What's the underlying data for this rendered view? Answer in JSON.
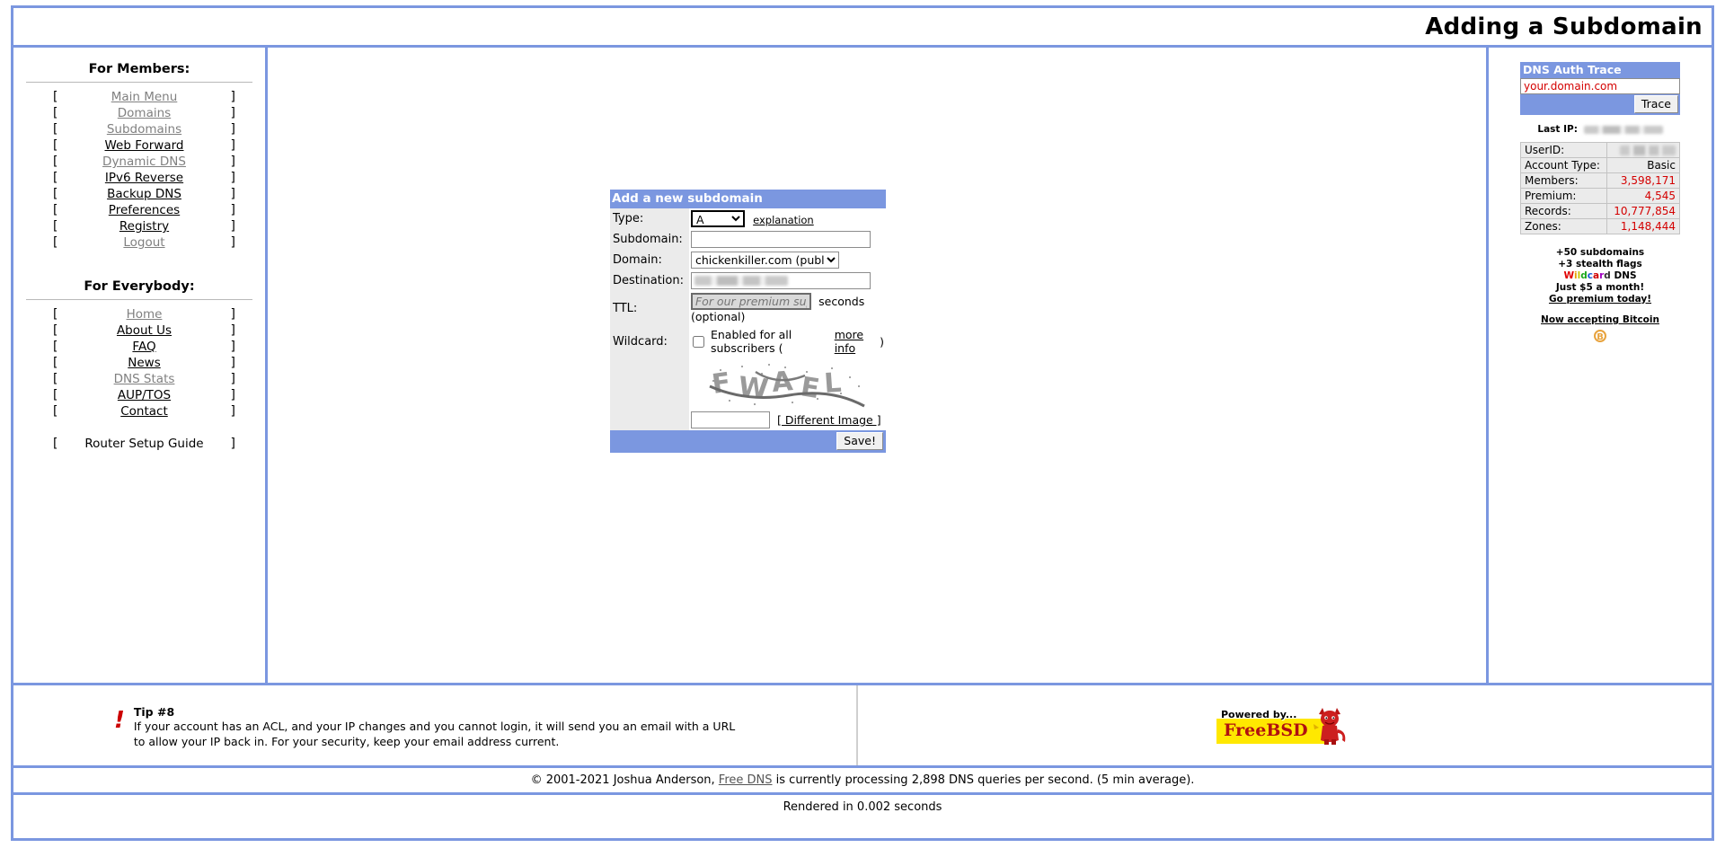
{
  "header": {
    "title": "Adding a Subdomain"
  },
  "sidebar": {
    "members_heading": "For Members:",
    "members": [
      {
        "label": "Main Menu",
        "state": "visited"
      },
      {
        "label": "Domains",
        "state": "visited"
      },
      {
        "label": "Subdomains",
        "state": "visited"
      },
      {
        "label": "Web Forward",
        "state": "unvisited"
      },
      {
        "label": "Dynamic DNS",
        "state": "visited"
      },
      {
        "label": "IPv6 Reverse",
        "state": "unvisited"
      },
      {
        "label": "Backup DNS",
        "state": "unvisited"
      },
      {
        "label": "Preferences",
        "state": "unvisited"
      },
      {
        "label": "Registry",
        "state": "unvisited"
      },
      {
        "label": "Logout",
        "state": "visited"
      }
    ],
    "everybody_heading": "For Everybody:",
    "everybody": [
      {
        "label": "Home",
        "state": "visited"
      },
      {
        "label": "About Us",
        "state": "unvisited"
      },
      {
        "label": "FAQ",
        "state": "unvisited"
      },
      {
        "label": "News",
        "state": "unvisited"
      },
      {
        "label": "DNS Stats",
        "state": "visited"
      },
      {
        "label": "AUP/TOS",
        "state": "unvisited"
      },
      {
        "label": "Contact",
        "state": "unvisited"
      }
    ],
    "extra": [
      {
        "label": "Router Setup Guide",
        "state": "plain"
      }
    ],
    "bracket_open": "[",
    "bracket_close": "]"
  },
  "form": {
    "title": "Add a new subdomain",
    "type_label": "Type:",
    "type_value": "A",
    "type_options": [
      "A"
    ],
    "type_explanation_link": "explanation",
    "subdomain_label": "Subdomain:",
    "subdomain_value": "",
    "domain_label": "Domain:",
    "domain_value": "chickenkiller.com (public)",
    "domain_options": [
      "chickenkiller.com (public)"
    ],
    "destination_label": "Destination:",
    "destination_value": "",
    "ttl_label": "TTL:",
    "ttl_placeholder": "For our premium supporters",
    "ttl_note": "seconds (optional)",
    "wildcard_label": "Wildcard:",
    "wildcard_text": "Enabled for all subscribers (",
    "wildcard_more_info": "more info",
    "wildcard_text_end": ")",
    "wildcard_checked": false,
    "captcha_text": "FWAEL",
    "captcha_input_value": "",
    "different_image_link": "[ Different Image ]",
    "save_label": "Save!"
  },
  "trace": {
    "title": "DNS Auth Trace",
    "domain_value": "your.domain.com",
    "button_label": "Trace",
    "last_ip_label": "Last IP:",
    "last_ip_value": ""
  },
  "stats": {
    "rows": [
      {
        "key": "UserID:",
        "value": "",
        "red": false,
        "redacted": true
      },
      {
        "key": "Account Type:",
        "value": "Basic",
        "red": false,
        "redacted": false
      },
      {
        "key": "Members:",
        "value": "3,598,171",
        "red": true,
        "redacted": false
      },
      {
        "key": "Premium:",
        "value": "4,545",
        "red": true,
        "redacted": false
      },
      {
        "key": "Records:",
        "value": "10,777,854",
        "red": true,
        "redacted": false
      },
      {
        "key": "Zones:",
        "value": "1,148,444",
        "red": true,
        "redacted": false
      }
    ]
  },
  "promo": {
    "line1": "+50 subdomains",
    "line2": "+3 stealth flags",
    "wildcard_word": "Wildcard",
    "wildcard_suffix": " DNS",
    "line4": "Just $5 a month!",
    "go_premium": "Go premium today!",
    "bitcoin": "Now accepting Bitcoin",
    "bitcoin_symbol": "B"
  },
  "tip": {
    "title": "Tip #8",
    "line1": "If your account has an ACL, and your IP changes and you cannot login, it will send you an email with a URL",
    "line2": "to allow your IP back in. For your security, keep your email address current."
  },
  "bsd": {
    "powered": "Powered by...",
    "name": "FreeBSD"
  },
  "footer": {
    "copy_prefix": "© 2001-2021 Joshua Anderson, ",
    "copy_link": "Free DNS",
    "copy_suffix": " is currently processing 2,898 DNS queries per second. (5 min average).",
    "rendered": "Rendered in 0.002 seconds"
  },
  "colors": {
    "accent_blue": "#7b97e0",
    "stat_red": "#d40000",
    "tip_red": "#cc0000",
    "bsd_yellow": "#ffe800"
  }
}
